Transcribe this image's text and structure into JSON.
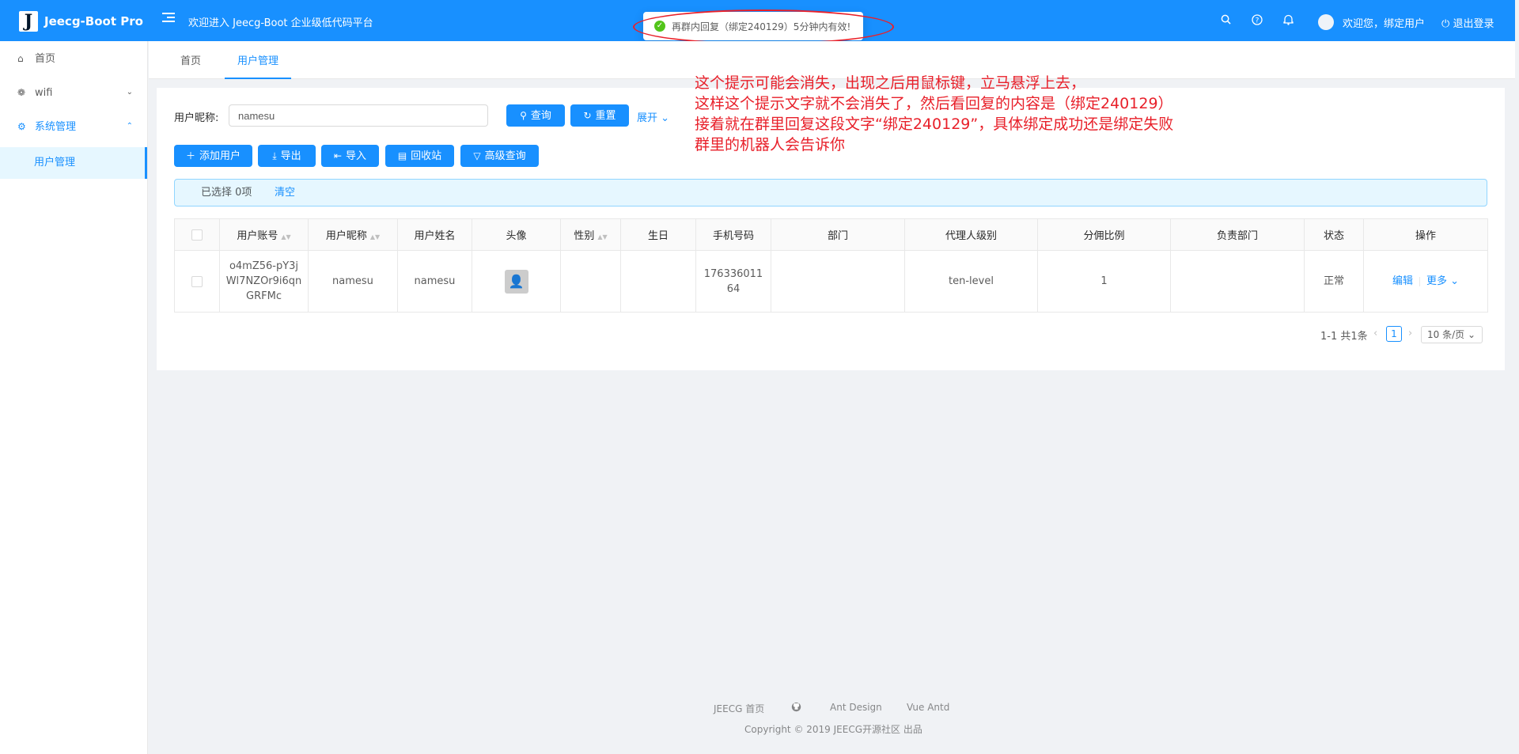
{
  "header": {
    "logo_letter": "J",
    "app_name": "Jeecg-Boot Pro",
    "welcome": "欢迎进入 Jeecg-Boot 企业级低代码平台",
    "user_greeting": "欢迎您，绑定用户",
    "logout": "退出登录",
    "icons": [
      "search-icon",
      "question-icon",
      "bell-icon"
    ]
  },
  "toast": {
    "message": "再群内回复（绑定240129）5分钟内有效!"
  },
  "sidebar": {
    "items": [
      {
        "label": "首页",
        "icon": "home-icon"
      },
      {
        "label": "wifi",
        "icon": "wifi-icon"
      },
      {
        "label": "系统管理",
        "icon": "setting-icon"
      }
    ],
    "sub_item": "用户管理"
  },
  "tabs": [
    {
      "label": "首页"
    },
    {
      "label": "用户管理"
    }
  ],
  "search": {
    "label": "用户昵称:",
    "value": "namesu",
    "query_btn": "查询",
    "reset_btn": "重置",
    "expand": "展开"
  },
  "toolbar": {
    "add": "添加用户",
    "export": "导出",
    "import": "导入",
    "recycle": "回收站",
    "advanced": "高级查询"
  },
  "alert": {
    "selected": "已选择 0项",
    "clear": "清空"
  },
  "table": {
    "columns": [
      "用户账号",
      "用户昵称",
      "用户姓名",
      "头像",
      "性别",
      "生日",
      "手机号码",
      "部门",
      "代理人级别",
      "分佣比例",
      "负责部门",
      "状态",
      "操作"
    ],
    "rows": [
      {
        "account": "o4mZ56-pY3jWl7NZOr9i6qnGRFMc",
        "nickname": "namesu",
        "name": "namesu",
        "gender": "",
        "birthday": "",
        "phone": "17633601164",
        "dept": "",
        "level": "ten-level",
        "ratio": "1",
        "resp_dept": "",
        "status": "正常",
        "edit": "编辑",
        "more": "更多"
      }
    ]
  },
  "pagination": {
    "total": "1-1 共1条",
    "current": "1",
    "size": "10 条/页"
  },
  "annotation": {
    "lines": [
      "这个提示可能会消失，出现之后用鼠标键，立马悬浮上去，",
      "这样这个提示文字就不会消失了，然后看回复的内容是（绑定240129）",
      "接着就在群里回复这段文字“绑定240129”，具体绑定成功还是绑定失败",
      "群里的机器人会告诉你"
    ]
  },
  "footer": {
    "links": [
      "JEECG 首页",
      "Ant Design",
      "Vue Antd"
    ],
    "github_icon": "github-icon",
    "copyright": "Copyright © 2019 JEECG开源社区 出品"
  },
  "colors": {
    "primary": "#1890ff",
    "annotation": "#e8202a",
    "success": "#52c41a"
  }
}
